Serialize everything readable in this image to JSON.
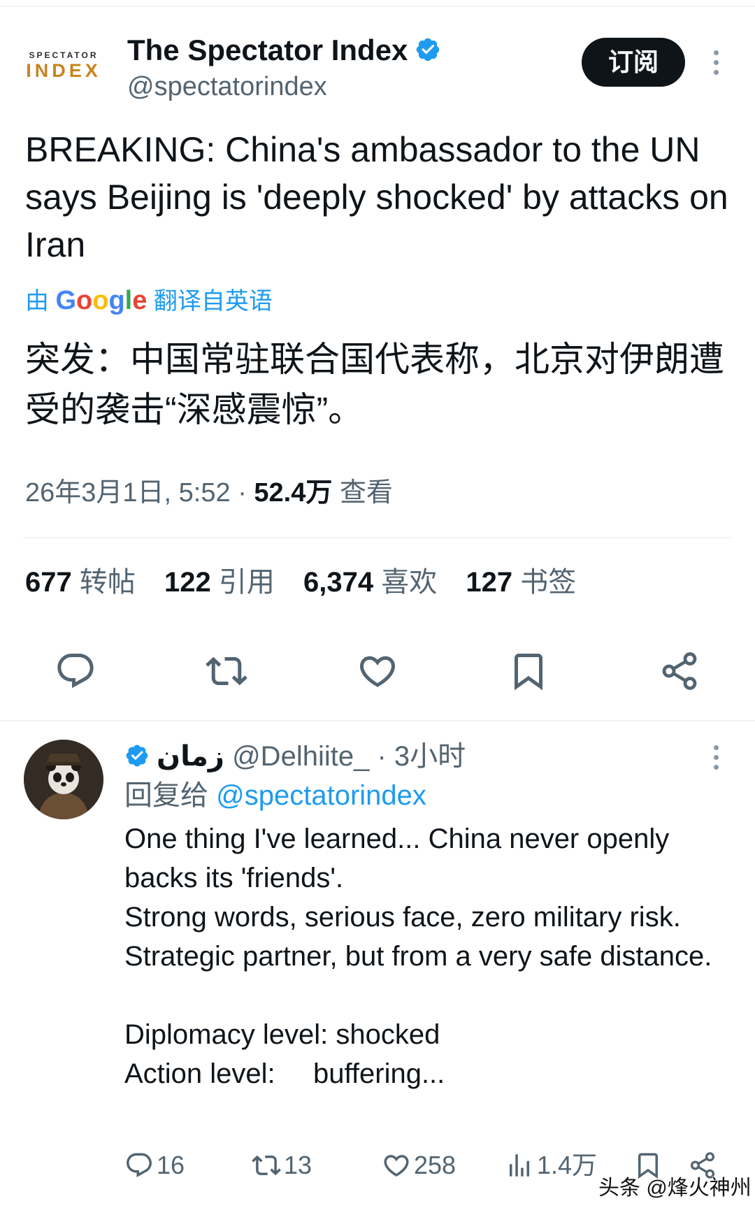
{
  "colors": {
    "accent": "#1d9bf0",
    "text": "#0f1419",
    "muted": "#536471",
    "divider": "#eff3f4"
  },
  "tweet": {
    "logo_top": "SPECTATOR",
    "logo_bottom": "INDEX",
    "author_name": "The Spectator Index",
    "handle": "@spectatorindex",
    "subscribe_label": "订阅",
    "text": "BREAKING: China's ambassador to the UN says Beijing is 'deeply shocked' by attacks on Iran",
    "translate_prefix": "由",
    "translate_brand": "Google",
    "translate_suffix": "翻译自英语",
    "translated_text": "突发：中国常驻联合国代表称，北京对伊朗遭受的袭击“深感震惊”。",
    "timestamp": "26年3月1日, 5:52",
    "meta_sep": "·",
    "views_count": "52.4万",
    "views_label": "查看",
    "stats": {
      "reposts_count": "677",
      "reposts_label": "转帖",
      "quotes_count": "122",
      "quotes_label": "引用",
      "likes_count": "6,374",
      "likes_label": "喜欢",
      "bookmarks_count": "127",
      "bookmarks_label": "书签"
    },
    "actions": [
      "reply-icon",
      "repost-icon",
      "like-icon",
      "bookmark-icon",
      "share-icon"
    ]
  },
  "reply": {
    "name": "زمان",
    "handle": "@Delhiite_",
    "time": "· 3小时",
    "replying_to_label": "回复给",
    "replying_to_handle": "@spectatorindex",
    "lines": [
      "One thing I've learned... China never openly backs its 'friends'.",
      "Strong words, serious face, zero military risk.",
      "Strategic partner, but from a very safe distance."
    ],
    "diplomacy_line": "Diplomacy level: shocked",
    "action_label": "Action level:",
    "action_value": "buffering...",
    "replies_count": "16",
    "reposts_count": "13",
    "likes_count": "258",
    "views_count": "1.4万"
  },
  "watermark": "头条 @烽火神州"
}
